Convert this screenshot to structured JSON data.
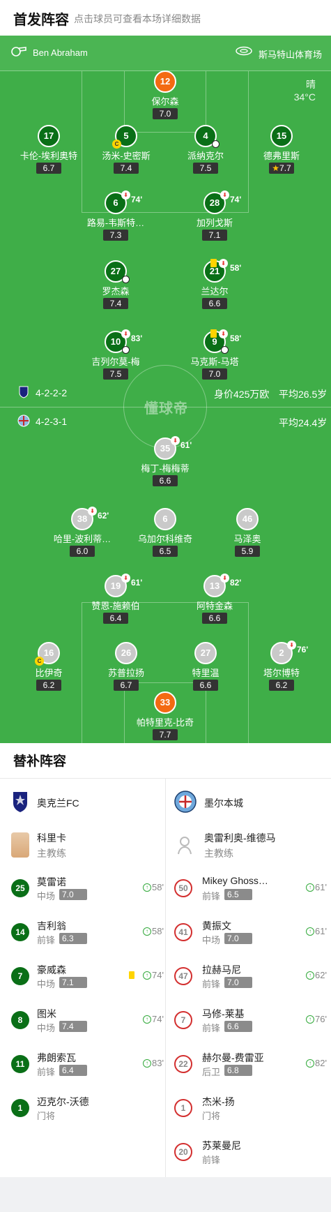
{
  "header": {
    "title": "首发阵容",
    "subtitle": "点击球员可查看本场详细数据"
  },
  "match_info": {
    "referee": "Ben Abraham",
    "venue": "斯马特山体育场",
    "weather": "晴",
    "temperature": "34°C"
  },
  "home": {
    "formation": "4-2-2-2",
    "value": "身价425万欧",
    "avg_age": "平均26.5岁",
    "team_name": "奥克兰FC",
    "coach": {
      "name": "科里卡",
      "role": "主教练"
    },
    "players": [
      {
        "num": "12",
        "name": "保尔森",
        "rating": "7.0",
        "gk": true
      },
      {
        "num": "17",
        "name": "卡伦-埃利奥特",
        "rating": "6.7"
      },
      {
        "num": "5",
        "name": "汤米-史密斯",
        "rating": "7.4",
        "captain": true
      },
      {
        "num": "4",
        "name": "派纳克尔",
        "rating": "7.5",
        "goal": true
      },
      {
        "num": "15",
        "name": "德弗里斯",
        "rating": "7.7",
        "star": true
      },
      {
        "num": "6",
        "name": "路易-韦斯特…",
        "rating": "7.3",
        "sub": "74'"
      },
      {
        "num": "28",
        "name": "加列戈斯",
        "rating": "7.1",
        "sub": "74'"
      },
      {
        "num": "27",
        "name": "罗杰森",
        "rating": "7.4"
      },
      {
        "num": "21",
        "name": "兰达尔",
        "rating": "6.6",
        "sub": "58'",
        "yellow": true
      },
      {
        "num": "10",
        "name": "吉列尔莫-梅",
        "rating": "7.5",
        "sub": "83'",
        "goal": true
      },
      {
        "num": "9",
        "name": "马克斯-马塔",
        "rating": "7.0",
        "sub": "58'",
        "yellow": true,
        "goal": true
      }
    ],
    "subs": [
      {
        "num": "25",
        "name": "莫雷诺",
        "pos": "中场",
        "rating": "7.0",
        "time": "58'"
      },
      {
        "num": "14",
        "name": "吉利翁",
        "pos": "前锋",
        "rating": "6.3",
        "time": "58'"
      },
      {
        "num": "7",
        "name": "豪威森",
        "pos": "中场",
        "rating": "7.1",
        "time": "74'",
        "yellow": true
      },
      {
        "num": "8",
        "name": "图米",
        "pos": "中场",
        "rating": "7.4",
        "time": "74'"
      },
      {
        "num": "11",
        "name": "弗朗索瓦",
        "pos": "前锋",
        "rating": "6.4",
        "time": "83'"
      },
      {
        "num": "1",
        "name": "迈克尔-沃德",
        "pos": "门将",
        "rating": "",
        "time": ""
      }
    ]
  },
  "away": {
    "formation": "4-2-3-1",
    "avg_age": "平均24.4岁",
    "team_name": "墨尔本城",
    "coach": {
      "name": "奥雷利奥-维德马",
      "role": "主教练"
    },
    "players": [
      {
        "num": "35",
        "name": "梅丁-梅梅蒂",
        "rating": "6.6",
        "sub": "61'"
      },
      {
        "num": "38",
        "name": "哈里-波利蒂…",
        "rating": "6.0",
        "sub": "62'"
      },
      {
        "num": "6",
        "name": "乌加尔科维奇",
        "rating": "6.5"
      },
      {
        "num": "46",
        "name": "马泽奥",
        "rating": "5.9"
      },
      {
        "num": "19",
        "name": "赞恩-施赖伯",
        "rating": "6.4",
        "sub": "61'"
      },
      {
        "num": "13",
        "name": "阿特金森",
        "rating": "6.6",
        "sub": "82'"
      },
      {
        "num": "16",
        "name": "比伊奇",
        "rating": "6.2",
        "captain": true
      },
      {
        "num": "26",
        "name": "苏普拉扬",
        "rating": "6.7"
      },
      {
        "num": "27",
        "name": "特里温",
        "rating": "6.6"
      },
      {
        "num": "2",
        "name": "塔尔博特",
        "rating": "6.2",
        "sub": "76'"
      },
      {
        "num": "33",
        "name": "帕特里克-比奇",
        "rating": "7.7",
        "gk": true
      }
    ],
    "subs": [
      {
        "num": "50",
        "name": "Mikey Ghoss…",
        "pos": "前锋",
        "rating": "6.5",
        "time": "61'"
      },
      {
        "num": "41",
        "name": "黄振文",
        "pos": "中场",
        "rating": "7.0",
        "time": "61'"
      },
      {
        "num": "47",
        "name": "拉赫马尼",
        "pos": "前锋",
        "rating": "7.0",
        "time": "62'"
      },
      {
        "num": "7",
        "name": "马修-莱基",
        "pos": "前锋",
        "rating": "6.6",
        "time": "76'"
      },
      {
        "num": "22",
        "name": "赫尔曼-费雷亚",
        "pos": "后卫",
        "rating": "6.8",
        "time": "82'"
      },
      {
        "num": "1",
        "name": "杰米-扬",
        "pos": "门将",
        "rating": "",
        "time": ""
      },
      {
        "num": "20",
        "name": "苏莱曼尼",
        "pos": "前锋",
        "rating": "",
        "time": ""
      }
    ]
  },
  "bench_title": "替补阵容",
  "watermark": "懂球帝",
  "colors": {
    "pitch": "#3fae48",
    "home": "#0a6f17",
    "goalkeeper": "#f36a12",
    "away_ring": "#d32f2f"
  },
  "icons": {
    "referee": "whistle-icon",
    "venue": "stadium-icon",
    "home_crest": "auckland-fc-crest-icon",
    "away_crest": "melbourne-city-crest-icon",
    "coach": "avatar-icon",
    "sub_in": "arrow-up-icon",
    "sub_out": "arrow-down-icon",
    "goal": "soccer-ball-icon",
    "captain": "captain-band-icon"
  }
}
